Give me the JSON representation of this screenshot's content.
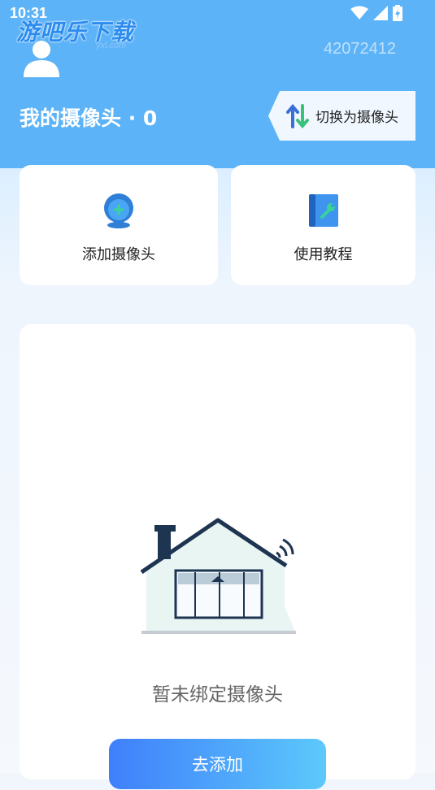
{
  "status_bar": {
    "time": "10:31"
  },
  "watermark": {
    "text": "游吧乐下载",
    "sub": "yxl.com"
  },
  "header": {
    "user_id": "42072412",
    "title": "我的摄像头 · 0",
    "switch_button_label": "切换为摄像头"
  },
  "quick_actions": [
    {
      "label": "添加摄像头",
      "icon": "webcam-icon"
    },
    {
      "label": "使用教程",
      "icon": "tutorial-book-icon"
    }
  ],
  "empty_state": {
    "message": "暂未绑定摄像头",
    "button_label": "去添加",
    "illustration": "house-with-camera-illustration"
  },
  "colors": {
    "header_bg": "#5db3f7",
    "accent_start": "#3f7ffb",
    "accent_end": "#5cc9fb"
  }
}
